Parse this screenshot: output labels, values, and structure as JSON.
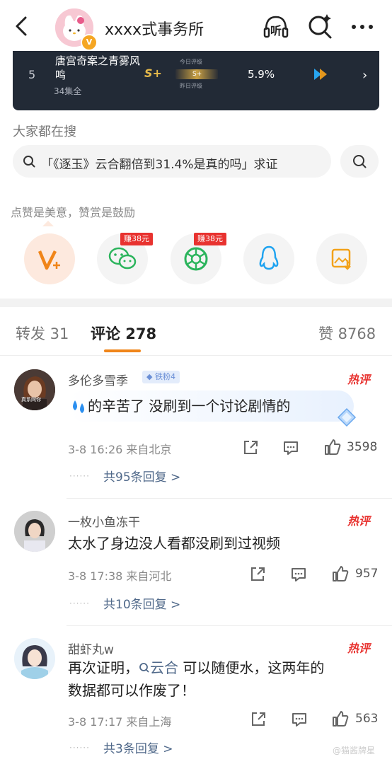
{
  "header": {
    "account_name": "xxxx式事务所",
    "verify_badge": "V",
    "icons": [
      "back-arrow-icon",
      "listen-icon",
      "search-icon",
      "more-icon"
    ],
    "listen_label": "听"
  },
  "banner": {
    "rank": "5",
    "title": "唐宫奇案之青雾风鸣",
    "episodes": "34集全",
    "grade": "S+",
    "grade_today_label": "今日评级",
    "grade_yesterday_label": "昨日评级",
    "grade_yesterday": "S+",
    "percent": "5.9%"
  },
  "search": {
    "section_label": "大家都在搜",
    "query": "「《逐玉》云合翻倍到31.4%是真的吗」求证"
  },
  "reward": {
    "title": "点赞是美意，赞赏是鼓励",
    "items": [
      {
        "name": "vplus",
        "earn": ""
      },
      {
        "name": "wechat",
        "earn": "赚38元"
      },
      {
        "name": "moments",
        "earn": "赚38元"
      },
      {
        "name": "qq",
        "earn": ""
      },
      {
        "name": "save-image",
        "earn": ""
      }
    ]
  },
  "tabs": {
    "repost": "转发 31",
    "comment": "评论 278",
    "like": "赞 8768"
  },
  "comments": [
    {
      "user": "多伦多雪季",
      "fan_badge": "铁粉4",
      "hot": "热评",
      "text_after_emoji": "的辛苦了 没刷到一个讨论剧情的",
      "time_loc": "3-8 16:26  来自北京",
      "likes": "3598",
      "replies": "共95条回复 >"
    },
    {
      "user": "一枚小鱼冻干",
      "hot": "热评",
      "text": "太水了身边没人看都没刷到过视频",
      "time_loc": "3-8 17:38  来自河北",
      "likes": "957",
      "replies": "共10条回复 >"
    },
    {
      "user": "甜虾丸w",
      "hot": "热评",
      "text_pre": "再次证明，",
      "topic_link": "云合",
      "text_post": " 可以随便水，这两年的",
      "text_line2": "数据都可以作废了！",
      "time_loc": "3-8 17:17  来自上海",
      "likes": "563",
      "replies": "共3条回复 >"
    }
  ],
  "avatar_caption": "真系同你",
  "watermark": "@猫酱牌星",
  "colors": {
    "accent": "#f08519",
    "hot": "#e8322f",
    "link": "#50698a"
  }
}
